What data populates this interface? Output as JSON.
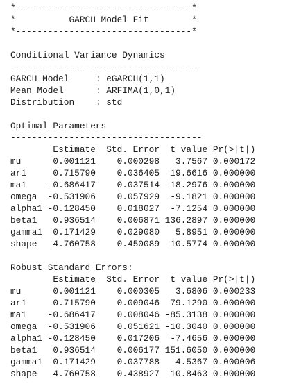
{
  "console": {
    "lines": [
      "*---------------------------------*",
      "*          GARCH Model Fit        *",
      "*---------------------------------*",
      "",
      "Conditional Variance Dynamics",
      "-----------------------------------",
      "GARCH Model     : eGARCH(1,1)",
      "Mean Model      : ARFIMA(1,0,1)",
      "Distribution    : std",
      "",
      "Optimal Parameters",
      "------------------------------------",
      "        Estimate  Std. Error  t value Pr(>|t|)",
      "mu      0.001121    0.000298   3.7567 0.000172",
      "ar1     0.715790    0.036405  19.6616 0.000000",
      "ma1    -0.686417    0.037514 -18.2976 0.000000",
      "omega  -0.531906    0.057929  -9.1821 0.000000",
      "alpha1 -0.128450    0.018027  -7.1254 0.000000",
      "beta1   0.936514    0.006871 136.2897 0.000000",
      "gamma1  0.171429    0.029080   5.8951 0.000000",
      "shape   4.760758    0.450089  10.5774 0.000000",
      "",
      "Robust Standard Errors:",
      "        Estimate  Std. Error  t value Pr(>|t|)",
      "mu      0.001121    0.000305   3.6806 0.000233",
      "ar1     0.715790    0.009046  79.1290 0.000000",
      "ma1    -0.686417    0.008046 -85.3138 0.000000",
      "omega  -0.531906    0.051621 -10.3040 0.000000",
      "alpha1 -0.128450    0.017206  -7.4656 0.000000",
      "beta1   0.936514    0.006177 151.6050 0.000000",
      "gamma1  0.171429    0.037788   4.5367 0.000006",
      "shape   4.760758    0.438927  10.8463 0.000000"
    ]
  }
}
